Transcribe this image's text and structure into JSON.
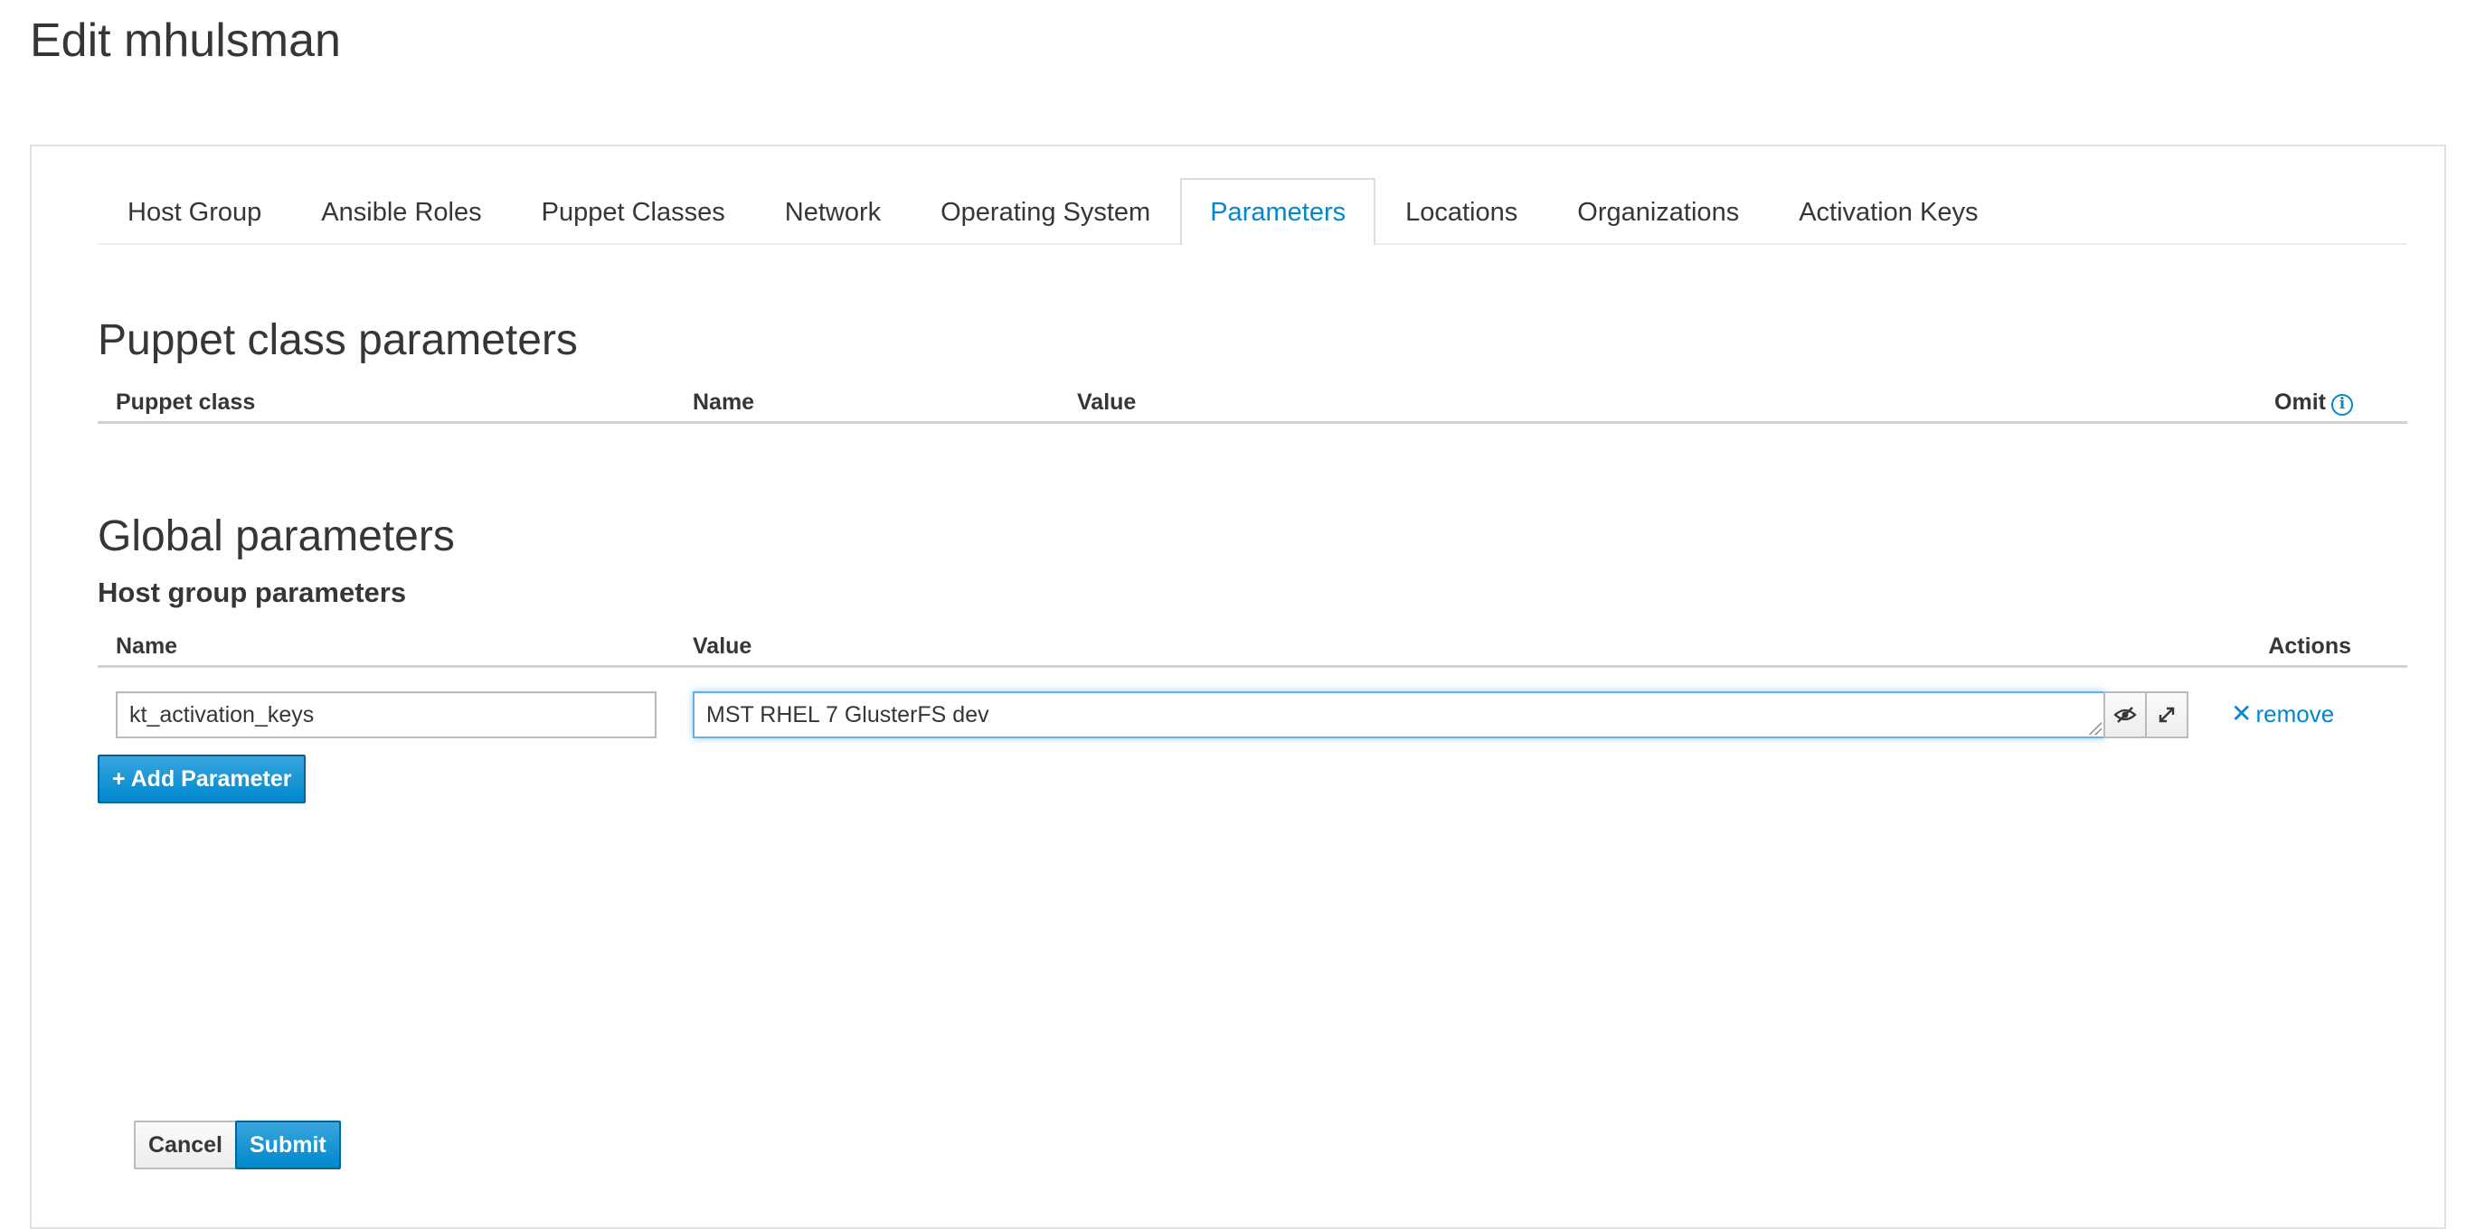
{
  "page": {
    "title": "Edit mhulsman"
  },
  "tabs": [
    {
      "label": "Host Group",
      "active": false
    },
    {
      "label": "Ansible Roles",
      "active": false
    },
    {
      "label": "Puppet Classes",
      "active": false
    },
    {
      "label": "Network",
      "active": false
    },
    {
      "label": "Operating System",
      "active": false
    },
    {
      "label": "Parameters",
      "active": true
    },
    {
      "label": "Locations",
      "active": false
    },
    {
      "label": "Organizations",
      "active": false
    },
    {
      "label": "Activation Keys",
      "active": false
    }
  ],
  "puppet_params": {
    "title": "Puppet class parameters",
    "columns": {
      "puppet_class": "Puppet class",
      "name": "Name",
      "value": "Value",
      "omit": "Omit"
    },
    "info_icon": "info-circle-icon"
  },
  "global_params": {
    "title": "Global parameters",
    "subtitle": "Host group parameters",
    "columns": {
      "name": "Name",
      "value": "Value",
      "actions": "Actions"
    },
    "rows": [
      {
        "name": "kt_activation_keys",
        "value": "MST RHEL 7 GlusterFS dev",
        "hide_icon": "eye-slash-icon",
        "expand_icon": "expand-icon",
        "remove_label": "remove"
      }
    ],
    "add_button": "+ Add Parameter"
  },
  "form_actions": {
    "cancel": "Cancel",
    "submit": "Submit"
  },
  "colors": {
    "accent": "#0088ce",
    "text": "#363636",
    "focus_border": "#66afe9"
  }
}
